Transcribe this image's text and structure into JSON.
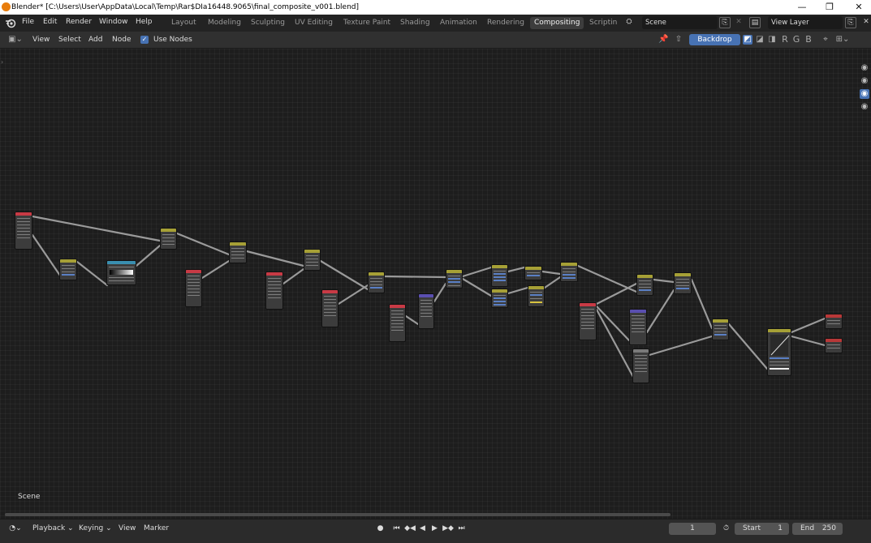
{
  "titlebar": {
    "title": "Blender* [C:\\Users\\User\\AppData\\Local\\Temp\\Rar$DIa16448.9065\\final_composite_v001.blend]",
    "minimize": "—",
    "restore": "❐",
    "close": "✕"
  },
  "menus": [
    "File",
    "Edit",
    "Render",
    "Window",
    "Help"
  ],
  "workspaces": [
    {
      "label": "Layout",
      "active": false
    },
    {
      "label": "Modeling",
      "active": false
    },
    {
      "label": "Sculpting",
      "active": false
    },
    {
      "label": "UV Editing",
      "active": false
    },
    {
      "label": "Texture Paint",
      "active": false
    },
    {
      "label": "Shading",
      "active": false
    },
    {
      "label": "Animation",
      "active": false
    },
    {
      "label": "Rendering",
      "active": false
    },
    {
      "label": "Compositing",
      "active": true
    },
    {
      "label": "Scriptin",
      "active": false
    }
  ],
  "scene": {
    "value": "Scene"
  },
  "view_layer": {
    "value": "View Layer"
  },
  "editor_header": {
    "menus": [
      "View",
      "Select",
      "Add",
      "Node"
    ],
    "use_nodes_label": "Use Nodes",
    "use_nodes_checked": true,
    "backdrop_label": "Backdrop",
    "channels": [
      "R",
      "G",
      "B"
    ]
  },
  "node_editor": {
    "scene_label": "Scene",
    "colors": {
      "input_header": "#c83a45",
      "filter_header": "#a6a036",
      "output_header": "#b83838",
      "converter_header": "#3a8fb0",
      "vector_header": "#5a4fb0",
      "socket_blue": "#5a7fc4"
    }
  },
  "timeline": {
    "playback_label": "Playback",
    "keying_label": "Keying",
    "view_label": "View",
    "marker_label": "Marker",
    "current_frame": "1",
    "start_label": "Start",
    "start_value": "1",
    "end_label": "End",
    "end_value": "250"
  },
  "icons": {
    "blender_logo": "blender-logo-icon",
    "record": "●",
    "jump_start": "⏮",
    "prev_key": "◆◀",
    "play_reverse": "◀",
    "play": "▶",
    "next_key": "▶◆",
    "jump_end": "⏭",
    "eye": "👁",
    "clock": "⏱"
  }
}
